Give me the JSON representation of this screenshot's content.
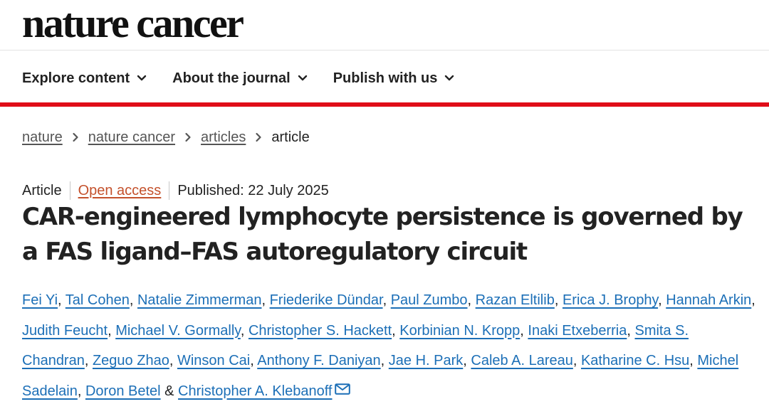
{
  "site": {
    "logo": "nature cancer"
  },
  "nav": [
    {
      "label": "Explore content"
    },
    {
      "label": "About the journal"
    },
    {
      "label": "Publish with us"
    }
  ],
  "breadcrumb": {
    "items": [
      "nature",
      "nature cancer",
      "articles"
    ],
    "current": "article"
  },
  "meta": {
    "type": "Article",
    "access": "Open access",
    "published": "Published: 22 July 2025"
  },
  "article": {
    "title": "CAR-engineered lymphocyte persistence is governed by a FAS ligand–FAS autoregulatory circuit"
  },
  "authors": {
    "list": [
      "Fei Yi",
      "Tal Cohen",
      "Natalie Zimmerman",
      "Friederike Dündar",
      "Paul Zumbo",
      "Razan Eltilib",
      "Erica J. Brophy",
      "Hannah Arkin",
      "Judith Feucht",
      "Michael V. Gormally",
      "Christopher S. Hackett",
      "Korbinian N. Kropp",
      "Inaki Etxeberria",
      "Smita S. Chandran",
      "Zeguo Zhao",
      "Winson Cai",
      "Anthony F. Daniyan",
      "Jae H. Park",
      "Caleb A. Lareau",
      "Katharine C. Hsu",
      "Michel Sadelain",
      "Doron Betel",
      "Christopher A. Klebanoff"
    ],
    "comma": ", ",
    "final_separator": " & "
  },
  "icons": {
    "nav_chevron": "chevron-down-icon",
    "breadcrumb_separator": "chevron-right-icon",
    "corresponding_author": "mail-icon"
  },
  "colors": {
    "accent_red": "#e00d18",
    "link_blue": "#1c6fb7",
    "open_access": "#c4512c",
    "text": "#222222",
    "muted_link": "#555555"
  }
}
